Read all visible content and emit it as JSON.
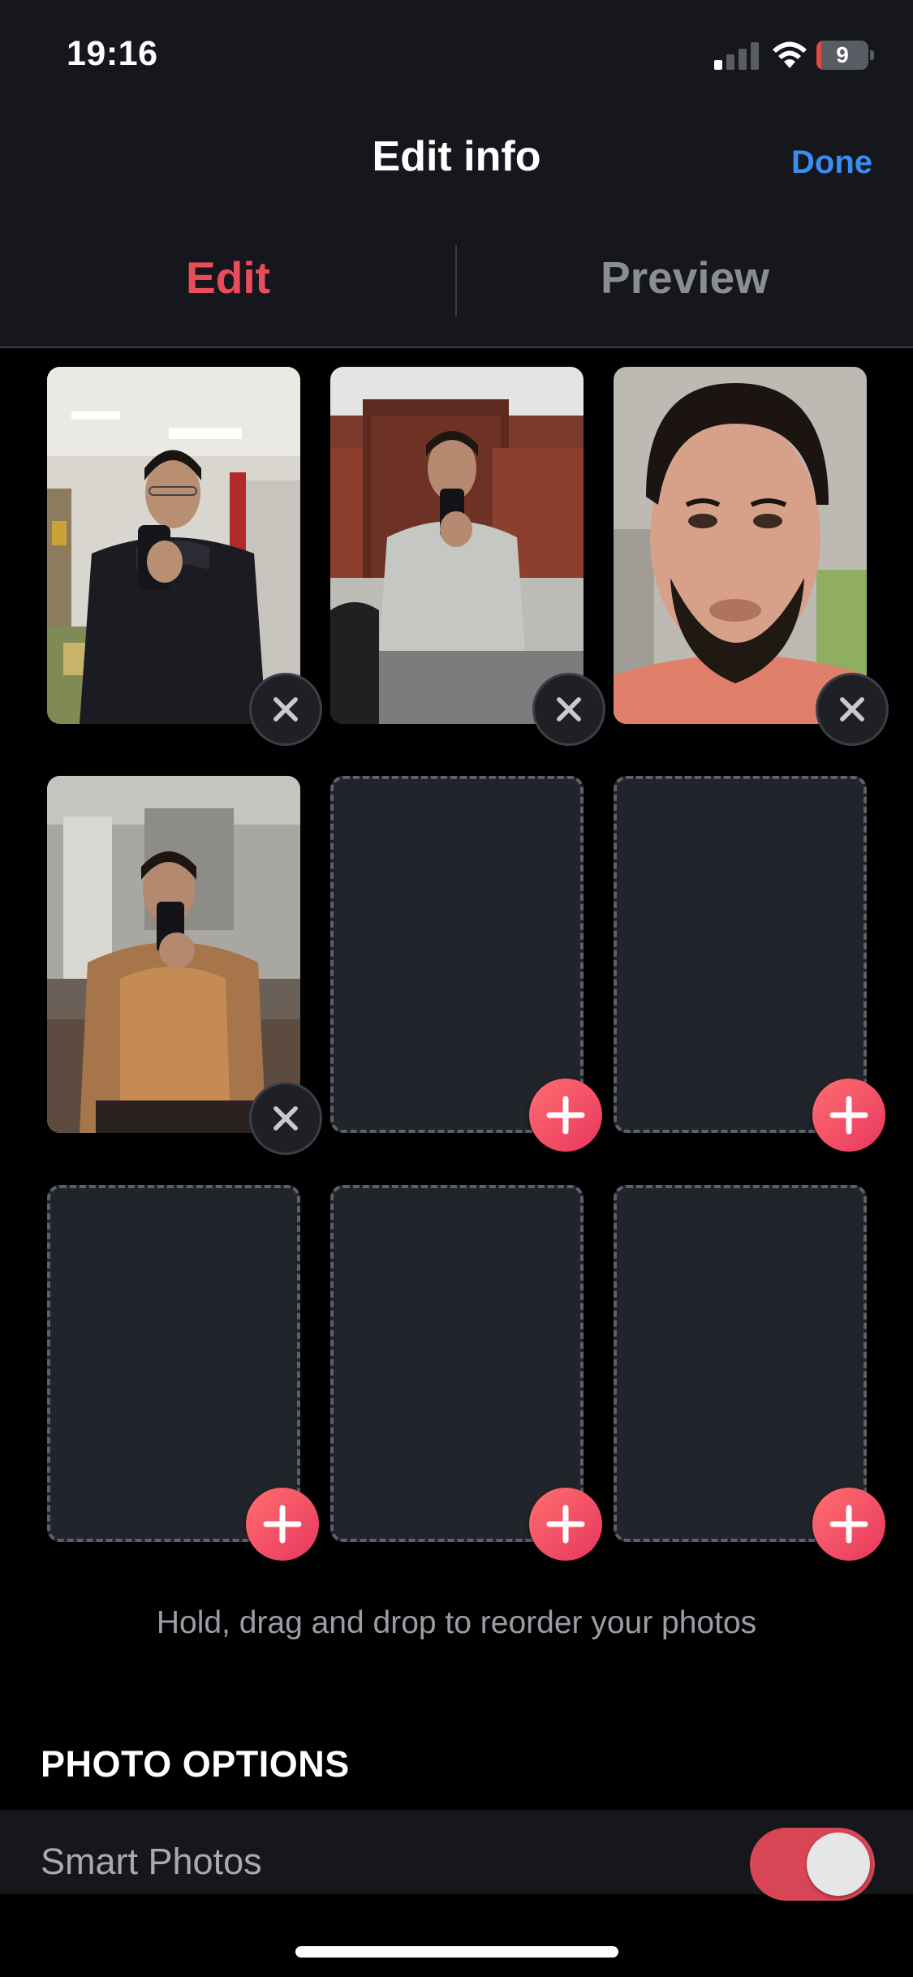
{
  "status_bar": {
    "time": "19:16",
    "battery_level": "9",
    "battery_fraction": 0.09,
    "signal_bars_active": 1,
    "signal_bars_total": 4,
    "icons": [
      "cellular-signal-icon",
      "wifi-icon",
      "battery-icon"
    ]
  },
  "nav": {
    "title": "Edit info",
    "done_label": "Done"
  },
  "tabs": [
    {
      "label": "Edit",
      "active": true
    },
    {
      "label": "Preview",
      "active": false
    }
  ],
  "photos": {
    "slots": [
      {
        "filled": true,
        "description": "mirror selfie in black puffer jacket"
      },
      {
        "filled": true,
        "description": "mirror selfie in grey t-shirt"
      },
      {
        "filled": true,
        "description": "close-up face selfie"
      },
      {
        "filled": true,
        "description": "mirror selfie in tan tank top"
      },
      {
        "filled": false
      },
      {
        "filled": false
      },
      {
        "filled": false
      },
      {
        "filled": false
      },
      {
        "filled": false
      }
    ],
    "hint": "Hold, drag and drop to reorder your photos"
  },
  "photo_options": {
    "section_title": "PHOTO OPTIONS",
    "smart_photos_label": "Smart Photos",
    "smart_photos_enabled": true
  },
  "colors": {
    "accent": "#e94d5c",
    "done": "#3b8cf3",
    "add_gradient_start": "#ff6f6f",
    "add_gradient_end": "#e8365e"
  }
}
